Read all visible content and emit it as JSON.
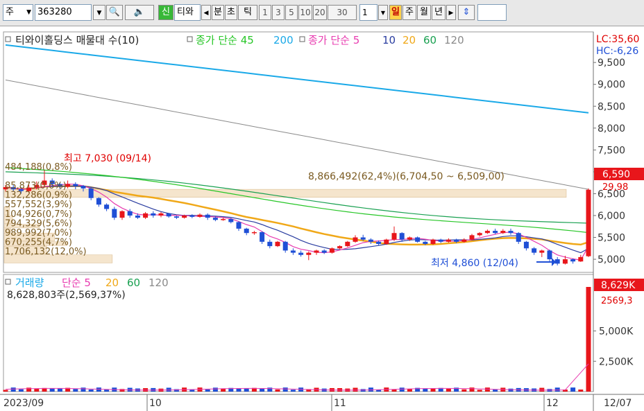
{
  "toolbar": {
    "market": "주",
    "code": "363280",
    "new_label": "신",
    "name": "티와",
    "period_left": "◀",
    "units": [
      "분",
      "초",
      "틱"
    ],
    "numbers": [
      "1",
      "3",
      "5",
      "10",
      "20",
      "30"
    ],
    "count": "1",
    "periods": [
      "일",
      "주",
      "월",
      "년"
    ],
    "active_period": "일",
    "period_right": "▶"
  },
  "colors": {
    "up": "#e8161b",
    "down": "#1f4fd6",
    "ma45": "#27c627",
    "ma200": "#1aa9e8",
    "ma5": "#e83cb0",
    "ma10": "#2a3da0",
    "ma20": "#f0a818",
    "ma60": "#18a050",
    "ma120": "#8a8a8a"
  },
  "chart_data": {
    "type": "candlestick",
    "x_ticks": [
      "2023/09",
      "10",
      "11",
      "12",
      "12/07"
    ],
    "price_panel": {
      "legend_title": "티와이홀딩스 매물대 수(10)",
      "legend_close": "종가 단순 45 200",
      "legend_close2": "종가 단순 5 10 20 60 120",
      "legend_periods": [
        "5",
        "10",
        "20",
        "60",
        "120"
      ],
      "y_ticks": [
        "9,500",
        "9,000",
        "8,500",
        "8,000",
        "7,500",
        "7,000",
        "6,500",
        "6,000",
        "5,500",
        "5,000"
      ],
      "ylim": [
        4700,
        10200
      ],
      "lc": "LC:35,60",
      "hc": "HC:-6,26",
      "current_price": "6,590",
      "current_change": "29,98",
      "high_label": "최고 7,030 (09/14)",
      "low_label": "최저 4,860 (12/04)",
      "volume_profile": {
        "bars": [
          {
            "price_low": 6400,
            "price_high": 6600,
            "volume": 8866492
          },
          {
            "price_low": 6000,
            "price_high": 6200,
            "volume": 85873
          },
          {
            "price_low": 5800,
            "price_high": 6000,
            "volume": 132286
          },
          {
            "price_low": 5700,
            "price_high": 5800,
            "volume": 557552
          },
          {
            "price_low": 5600,
            "price_high": 5700,
            "volume": 104926
          },
          {
            "price_low": 5400,
            "price_high": 5600,
            "volume": 794329
          },
          {
            "price_low": 5300,
            "price_high": 5400,
            "volume": 989992
          },
          {
            "price_low": 5100,
            "price_high": 5300,
            "volume": 670255
          },
          {
            "price_low": 4900,
            "price_high": 5100,
            "volume": 1706132
          }
        ],
        "label_top": "484,188(0,8%)",
        "max_label": "8,866,492(62,4%)(6,704,50 ~ 6,509,00)",
        "labels": [
          "85,873(0,6%)",
          "132,286(0,9%)",
          "557,552(3,9%)",
          "104,926(0,7%)",
          "794,329(5,6%)",
          "989,992(7,0%)",
          "670,255(4,7%)",
          "1,706,132(12,0%)"
        ]
      },
      "ma200": [
        9900,
        8350
      ],
      "ma120": [
        9100,
        6600
      ],
      "ma60_start": 7000,
      "ma60_end": 5800,
      "ma45_start": 7100,
      "ma45_end": 5520,
      "candles": [
        {
          "o": 6600,
          "c": 6650,
          "h": 6700,
          "l": 6550
        },
        {
          "o": 6650,
          "c": 6600,
          "h": 6700,
          "l": 6550
        },
        {
          "o": 6600,
          "c": 6560,
          "h": 6650,
          "l": 6500
        },
        {
          "o": 6560,
          "c": 6640,
          "h": 6700,
          "l": 6520
        },
        {
          "o": 6640,
          "c": 6700,
          "h": 6780,
          "l": 6600
        },
        {
          "o": 6700,
          "c": 6800,
          "h": 7030,
          "l": 6650
        },
        {
          "o": 6800,
          "c": 6720,
          "h": 6850,
          "l": 6650
        },
        {
          "o": 6720,
          "c": 6660,
          "h": 6760,
          "l": 6600
        },
        {
          "o": 6660,
          "c": 6720,
          "h": 6800,
          "l": 6620
        },
        {
          "o": 6720,
          "c": 6680,
          "h": 6760,
          "l": 6600
        },
        {
          "o": 6680,
          "c": 6620,
          "h": 6700,
          "l": 6550
        },
        {
          "o": 6620,
          "c": 6400,
          "h": 6650,
          "l": 6350
        },
        {
          "o": 6400,
          "c": 6250,
          "h": 6420,
          "l": 6200
        },
        {
          "o": 6250,
          "c": 6150,
          "h": 6280,
          "l": 6100
        },
        {
          "o": 6150,
          "c": 5950,
          "h": 6200,
          "l": 5900
        },
        {
          "o": 5950,
          "c": 6100,
          "h": 6120,
          "l": 5900
        },
        {
          "o": 6100,
          "c": 6000,
          "h": 6150,
          "l": 5950
        },
        {
          "o": 6000,
          "c": 5950,
          "h": 6050,
          "l": 5920
        },
        {
          "o": 5950,
          "c": 6050,
          "h": 6080,
          "l": 5920
        },
        {
          "o": 6050,
          "c": 6000,
          "h": 6100,
          "l": 5950
        },
        {
          "o": 6000,
          "c": 6050,
          "h": 6080,
          "l": 5960
        },
        {
          "o": 6050,
          "c": 5980,
          "h": 6060,
          "l": 5950
        },
        {
          "o": 5980,
          "c": 5950,
          "h": 6000,
          "l": 5920
        },
        {
          "o": 5950,
          "c": 6000,
          "h": 6020,
          "l": 5930
        },
        {
          "o": 6000,
          "c": 5970,
          "h": 6030,
          "l": 5940
        },
        {
          "o": 5970,
          "c": 6020,
          "h": 6050,
          "l": 5950
        },
        {
          "o": 6020,
          "c": 5950,
          "h": 6050,
          "l": 5900
        },
        {
          "o": 5950,
          "c": 5900,
          "h": 5980,
          "l": 5870
        },
        {
          "o": 5900,
          "c": 5920,
          "h": 5950,
          "l": 5880
        },
        {
          "o": 5920,
          "c": 5850,
          "h": 5940,
          "l": 5820
        },
        {
          "o": 5850,
          "c": 5700,
          "h": 5870,
          "l": 5650
        },
        {
          "o": 5700,
          "c": 5600,
          "h": 5720,
          "l": 5550
        },
        {
          "o": 5600,
          "c": 5620,
          "h": 5650,
          "l": 5560
        },
        {
          "o": 5620,
          "c": 5400,
          "h": 5640,
          "l": 5350
        },
        {
          "o": 5400,
          "c": 5300,
          "h": 5450,
          "l": 5250
        },
        {
          "o": 5300,
          "c": 5400,
          "h": 5420,
          "l": 5280
        },
        {
          "o": 5400,
          "c": 5200,
          "h": 5420,
          "l": 5150
        },
        {
          "o": 5200,
          "c": 5150,
          "h": 5250,
          "l": 5100
        },
        {
          "o": 5150,
          "c": 5100,
          "h": 5200,
          "l": 5060
        },
        {
          "o": 5100,
          "c": 5150,
          "h": 5180,
          "l": 4980
        },
        {
          "o": 5150,
          "c": 5200,
          "h": 5220,
          "l": 5100
        },
        {
          "o": 5200,
          "c": 5150,
          "h": 5230,
          "l": 5120
        },
        {
          "o": 5150,
          "c": 5250,
          "h": 5270,
          "l": 5130
        },
        {
          "o": 5250,
          "c": 5300,
          "h": 5320,
          "l": 5230
        },
        {
          "o": 5300,
          "c": 5400,
          "h": 5420,
          "l": 5280
        },
        {
          "o": 5400,
          "c": 5500,
          "h": 5550,
          "l": 5380
        },
        {
          "o": 5500,
          "c": 5450,
          "h": 5560,
          "l": 5420
        },
        {
          "o": 5450,
          "c": 5400,
          "h": 5480,
          "l": 5350
        },
        {
          "o": 5400,
          "c": 5350,
          "h": 5430,
          "l": 5320
        },
        {
          "o": 5350,
          "c": 5450,
          "h": 5470,
          "l": 5330
        },
        {
          "o": 5450,
          "c": 5600,
          "h": 5750,
          "l": 5420
        },
        {
          "o": 5600,
          "c": 5450,
          "h": 5620,
          "l": 5400
        },
        {
          "o": 5450,
          "c": 5500,
          "h": 5520,
          "l": 5420
        },
        {
          "o": 5500,
          "c": 5400,
          "h": 5520,
          "l": 5380
        },
        {
          "o": 5400,
          "c": 5350,
          "h": 5420,
          "l": 5320
        },
        {
          "o": 5350,
          "c": 5450,
          "h": 5470,
          "l": 5330
        },
        {
          "o": 5450,
          "c": 5400,
          "h": 5470,
          "l": 5370
        },
        {
          "o": 5400,
          "c": 5450,
          "h": 5480,
          "l": 5380
        },
        {
          "o": 5450,
          "c": 5400,
          "h": 5470,
          "l": 5370
        },
        {
          "o": 5400,
          "c": 5450,
          "h": 5480,
          "l": 5380
        },
        {
          "o": 5450,
          "c": 5550,
          "h": 5580,
          "l": 5430
        },
        {
          "o": 5550,
          "c": 5600,
          "h": 5620,
          "l": 5520
        },
        {
          "o": 5600,
          "c": 5650,
          "h": 5680,
          "l": 5580
        },
        {
          "o": 5650,
          "c": 5600,
          "h": 5700,
          "l": 5570
        },
        {
          "o": 5600,
          "c": 5650,
          "h": 5690,
          "l": 5580
        },
        {
          "o": 5650,
          "c": 5600,
          "h": 5700,
          "l": 5560
        },
        {
          "o": 5600,
          "c": 5400,
          "h": 5620,
          "l": 5350
        },
        {
          "o": 5400,
          "c": 5250,
          "h": 5420,
          "l": 5200
        },
        {
          "o": 5250,
          "c": 5150,
          "h": 5280,
          "l": 5100
        },
        {
          "o": 5150,
          "c": 5200,
          "h": 5220,
          "l": 5050
        },
        {
          "o": 5200,
          "c": 5000,
          "h": 5220,
          "l": 4950
        },
        {
          "o": 5000,
          "c": 4900,
          "h": 5050,
          "l": 4860
        },
        {
          "o": 4900,
          "c": 5000,
          "h": 5080,
          "l": 4880
        },
        {
          "o": 5000,
          "c": 4950,
          "h": 5020,
          "l": 4900
        },
        {
          "o": 4950,
          "c": 5050,
          "h": 5100,
          "l": 4940
        },
        {
          "o": 5070,
          "c": 6590,
          "h": 6620,
          "l": 5050
        }
      ]
    },
    "volume_panel": {
      "legend_title": "거래량",
      "legend_ma": "단순 5 20 60 120",
      "legend_periods": [
        "5",
        "20",
        "60",
        "120"
      ],
      "summary": "8,628,803주(2,569,37%)",
      "current_volume": "8,629K",
      "current_change": "2569,3",
      "y_ticks": [
        "5,000K",
        "2,500K"
      ],
      "ylim": [
        0,
        9200000
      ],
      "last_volume": 8628803,
      "typical_volume": 240000
    }
  }
}
